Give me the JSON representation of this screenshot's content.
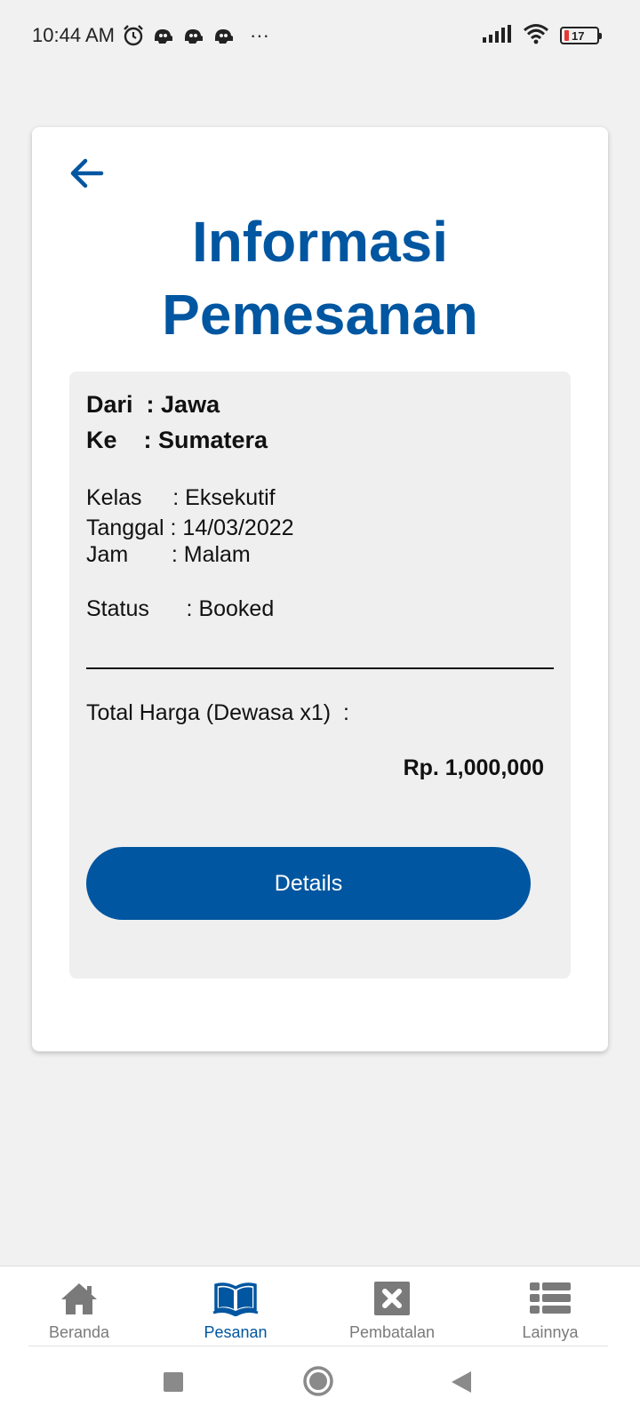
{
  "status_bar": {
    "time": "10:44 AM",
    "more": "···",
    "battery_level": "17",
    "icons": [
      "alarm-icon",
      "app-notification-icon",
      "app-notification-icon",
      "app-notification-icon",
      "signal-icon",
      "wifi-icon",
      "battery-icon"
    ]
  },
  "header": {
    "back_icon": "arrow-left-icon",
    "title": "Informasi Pemesanan"
  },
  "booking": {
    "from_label": "Dari  : ",
    "from_value": "Jawa",
    "to_label": "Ke    : ",
    "to_value": "Sumatera",
    "class_label": "Kelas     : ",
    "class_value": "Eksekutif",
    "date_label": "Tanggal : ",
    "date_value": "14/03/2022",
    "time_label": "Jam       : ",
    "time_value": "Malam",
    "status_label": "Status      : ",
    "status_value": "Booked",
    "total_label": "Total Harga (Dewasa x1)  :",
    "total_value": "Rp. 1,000,000",
    "details_button": "Details"
  },
  "bottom_nav": {
    "active": "Pesanan",
    "items": [
      {
        "label": "Beranda",
        "icon": "home-icon"
      },
      {
        "label": "Pesanan",
        "icon": "book-icon"
      },
      {
        "label": "Pembatalan",
        "icon": "cancel-icon"
      },
      {
        "label": "Lainnya",
        "icon": "list-icon"
      }
    ]
  },
  "colors": {
    "primary": "#0056a0",
    "panel": "#efefef",
    "background": "#f1f1f1",
    "battery_low": "#e53935"
  }
}
